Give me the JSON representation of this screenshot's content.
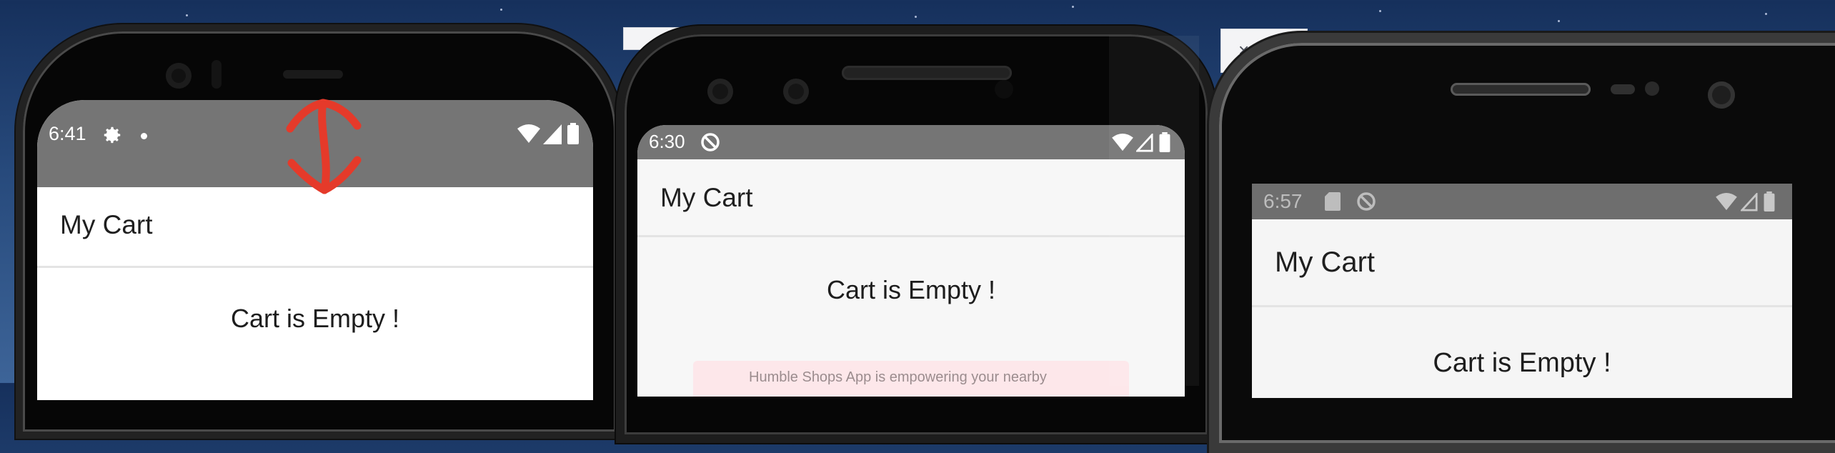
{
  "panels": [
    {
      "status": {
        "time": "6:41",
        "icons": [
          "gear-icon",
          "dot-icon",
          "wifi-icon",
          "signal-icon",
          "battery-icon"
        ]
      },
      "title": "My Cart",
      "empty_message": "Cart is Empty !",
      "annotation": {
        "icon": "double-arrow-icon",
        "color": "#e53a2a"
      }
    },
    {
      "status": {
        "time": "6:30",
        "icons": [
          "do-not-disturb-icon",
          "wifi-icon",
          "signal-icon",
          "battery-icon"
        ]
      },
      "title": "My Cart",
      "empty_message": "Cart is Empty !",
      "toast": "Humble Shops App is empowering your nearby"
    },
    {
      "status": {
        "time": "6:57",
        "icons": [
          "sd-card-icon",
          "do-not-disturb-icon",
          "wifi-icon",
          "signal-icon",
          "battery-icon"
        ]
      },
      "title": "My Cart",
      "empty_message": "Cart is Empty !"
    }
  ],
  "overlay": {
    "close_label": "×"
  },
  "colors": {
    "status_bar": "#757575",
    "app_bar": "#ffffff",
    "annotation": "#e53a2a",
    "toast_bg": "#fde7ea"
  }
}
